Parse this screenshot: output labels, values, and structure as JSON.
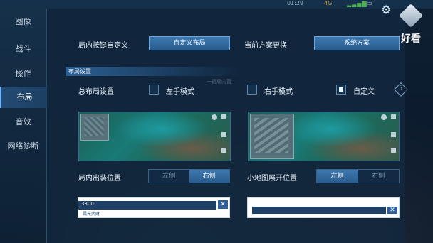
{
  "status": {
    "time": "01:29",
    "network": "4G",
    "signal": "▂▃▅▇",
    "battery": "▭"
  },
  "sidebar": {
    "items": [
      {
        "label": "图像"
      },
      {
        "label": "战斗"
      },
      {
        "label": "操作"
      },
      {
        "label": "布局",
        "active": true
      },
      {
        "label": "音效"
      },
      {
        "label": "网络诊断"
      }
    ]
  },
  "main": {
    "custom_key_label": "局内按键自定义",
    "custom_layout_button": "自定义布局",
    "current_scheme_label": "当前方案更换",
    "system_scheme_button": "系统方案",
    "section_title": "布局设置",
    "ghost_hint": "一键局内置",
    "total_layout_label": "总布局设置",
    "left_hand_label": "左手模式",
    "right_hand_label": "右手模式",
    "custom_label": "自定义",
    "custom_checked": true,
    "outfit_position_label": "局内出装位置",
    "outfit_options": [
      "左侧",
      "右侧"
    ],
    "outfit_selected": "右侧",
    "minimap_position_label": "小地图展开位置",
    "minimap_options": [
      "左侧",
      "右侧"
    ],
    "minimap_selected": "左侧",
    "bottom_preview_left_value": "3300",
    "bottom_preview_left_name": "霞光武财"
  },
  "brand": {
    "text": "好看"
  },
  "colors": {
    "accent": "#3d79b0",
    "panel": "#11263c",
    "active_tab": "#244c74"
  }
}
